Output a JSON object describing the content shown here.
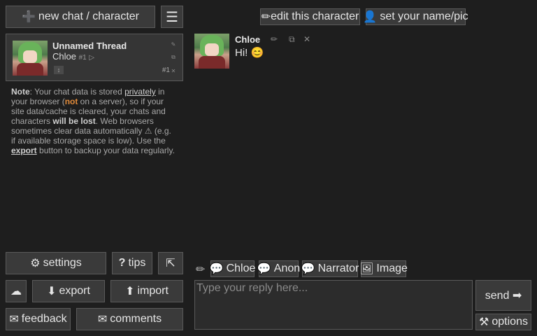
{
  "sidebar": {
    "new_chat": {
      "icon": "➕",
      "label": "new chat / character"
    },
    "menu_icon": "☰",
    "thread": {
      "title": "Unnamed Thread",
      "character": "Chloe",
      "character_num": "#1",
      "index": "#1",
      "up_glyph": "↕"
    },
    "note": {
      "lead": "Note",
      "p1": ": Your chat data is stored ",
      "privately": "privately",
      "p2": " in your browser (",
      "not": "not",
      "p3": " on a server), so if your site data/cache is cleared, your chats and characters ",
      "will_be_lost": "will be lost",
      "p4": ". Web browsers sometimes clear data automatically ⚠ (e.g. if available storage space is low). Use the ",
      "export": "export",
      "p5": " button to backup your data regularly."
    },
    "settings": {
      "icon": "⚙",
      "label": "settings"
    },
    "tips": {
      "icon": "?",
      "label": "tips"
    },
    "collapse_icon": "⇱",
    "extra_icon": "☁",
    "export": {
      "icon": "⬇",
      "label": "export"
    },
    "import": {
      "icon": "⬆",
      "label": "import"
    },
    "feedback": {
      "icon": "✉",
      "label": "feedback"
    },
    "comments": {
      "icon": "✉",
      "label": "comments"
    }
  },
  "header": {
    "edit_character": {
      "icon": "✏",
      "label": "edit this character"
    },
    "set_name": {
      "icon": "👤",
      "label": "set your name/pic"
    }
  },
  "messages": [
    {
      "author": "Chloe",
      "text": "Hi! 😊"
    }
  ],
  "composer": {
    "shortcuts": [
      {
        "icon": "💬",
        "label": "Chloe"
      },
      {
        "icon": "💬",
        "label": "Anon"
      },
      {
        "icon": "💬",
        "label": "Narrator"
      },
      {
        "icon": "🖼",
        "label": "Image"
      }
    ],
    "placeholder": "Type your reply here...",
    "send_label": "send ➡",
    "options": {
      "icon": "⚒",
      "label": "options"
    }
  }
}
